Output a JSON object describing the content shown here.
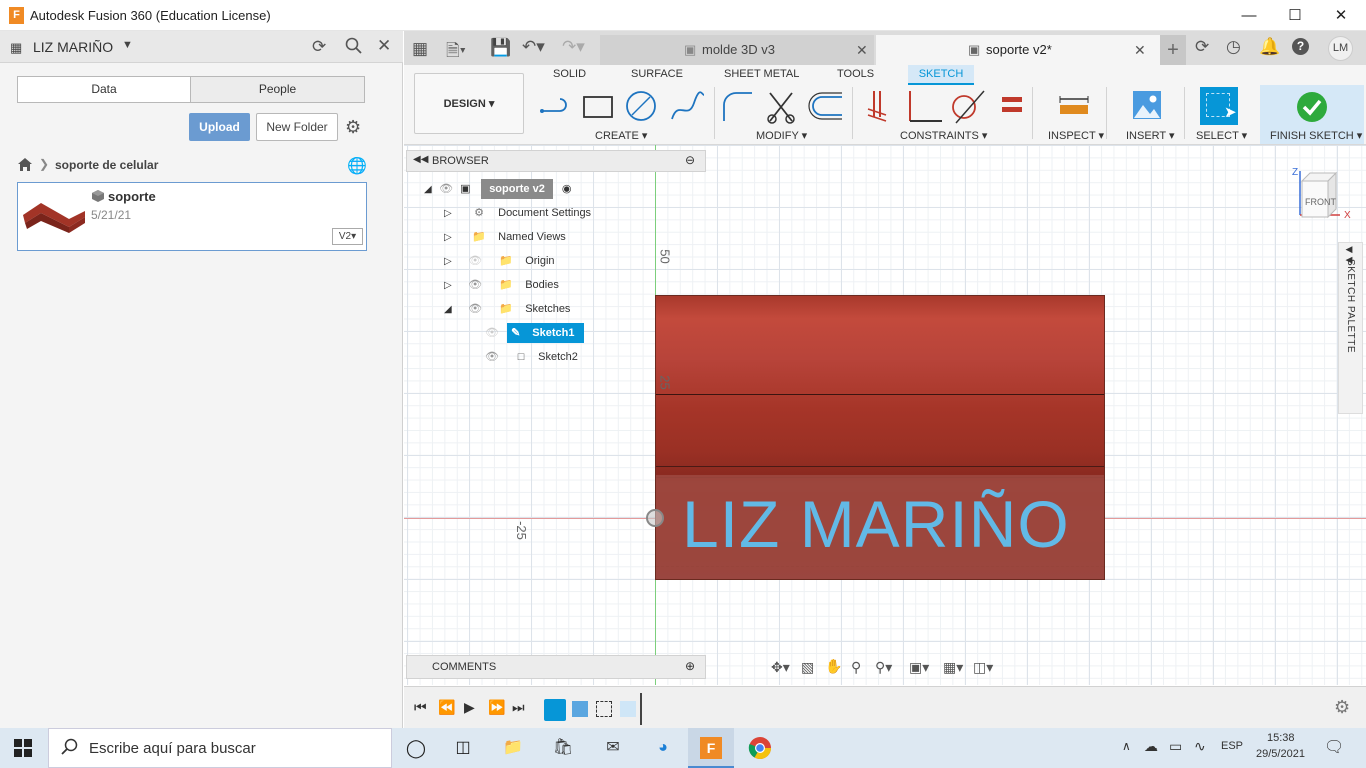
{
  "window": {
    "title": "Autodesk Fusion 360 (Education License)",
    "app_icon_letter": "F"
  },
  "data_panel": {
    "project": "LIZ MARIÑO",
    "tabs": [
      "Data",
      "People"
    ],
    "upload_label": "Upload",
    "new_folder_label": "New Folder",
    "breadcrumb": "soporte de celular",
    "file": {
      "name": "soporte",
      "date": "5/21/21",
      "version": "V2"
    }
  },
  "doc_tabs": [
    {
      "label": "molde 3D v3",
      "active": false
    },
    {
      "label": "soporte v2*",
      "active": true
    }
  ],
  "user_initials": "LM",
  "ribbon": {
    "workspace": "DESIGN",
    "tabs": [
      "SOLID",
      "SURFACE",
      "SHEET METAL",
      "TOOLS",
      "SKETCH"
    ],
    "active_tab": "SKETCH",
    "groups": [
      "CREATE",
      "MODIFY",
      "CONSTRAINTS",
      "INSPECT",
      "INSERT",
      "SELECT",
      "FINISH SKETCH"
    ]
  },
  "browser": {
    "title": "BROWSER",
    "root": "soporte v2",
    "items": [
      "Document Settings",
      "Named Views",
      "Origin",
      "Bodies",
      "Sketches"
    ],
    "sketches": [
      "Sketch1",
      "Sketch2"
    ]
  },
  "canvas": {
    "ruler_labels": [
      "50",
      "25",
      "-25"
    ],
    "model_text": "LIZ MARIÑO",
    "viewcube_label": "FRONT",
    "axes": {
      "z": "Z",
      "x": "X"
    }
  },
  "comments_label": "COMMENTS",
  "sketch_palette_label": "SKETCH PALETTE",
  "taskbar": {
    "search_placeholder": "Escribe aquí para buscar",
    "language": "ESP",
    "time": "15:38",
    "date": "29/5/2021"
  },
  "colors": {
    "accent": "#0696d7",
    "model": "#a63a2e",
    "model_text": "#62b9e6",
    "finish_check": "#2eaa3c"
  }
}
